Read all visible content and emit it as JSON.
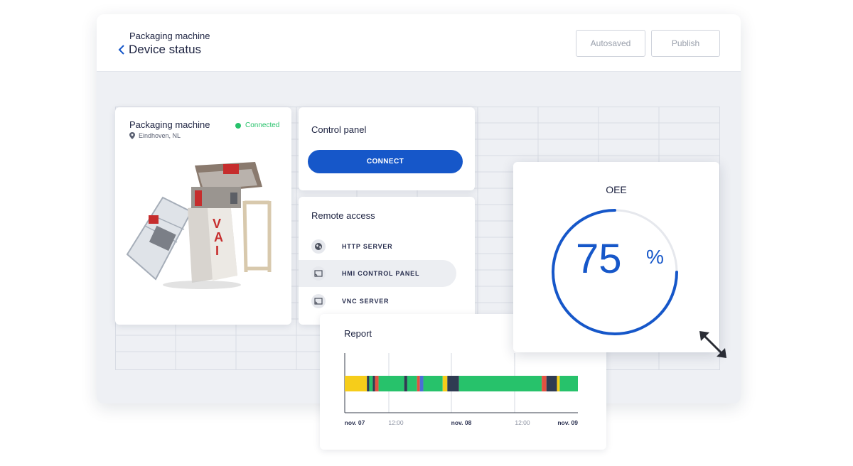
{
  "header": {
    "subtitle": "Packaging machine",
    "title": "Device status",
    "autosaved_label": "Autosaved",
    "publish_label": "Publish"
  },
  "device": {
    "name": "Packaging machine",
    "status": "Connected",
    "location": "Eindhoven, NL",
    "status_color": "#27c26b"
  },
  "control_panel": {
    "title": "Control panel",
    "connect_label": "CONNECT",
    "button_color": "#1657c9"
  },
  "remote_access": {
    "title": "Remote access",
    "items": [
      {
        "label": "HTTP SERVER",
        "icon": "globe-icon",
        "active": false
      },
      {
        "label": "HMI CONTROL PANEL",
        "icon": "cast-icon",
        "active": true
      },
      {
        "label": "VNC SERVER",
        "icon": "cast-icon",
        "active": false
      }
    ]
  },
  "report": {
    "title": "Report",
    "axis_labels": [
      {
        "label": "nov. 07",
        "bold": true
      },
      {
        "label": "12:00",
        "bold": false
      },
      {
        "label": "nov. 08",
        "bold": true
      },
      {
        "label": "12:00",
        "bold": false
      },
      {
        "label": "nov. 09",
        "bold": true
      }
    ],
    "timeline_segments": [
      {
        "start": 0.0,
        "end": 0.095,
        "color": "#f6cd1a"
      },
      {
        "start": 0.095,
        "end": 0.105,
        "color": "#2f3b52"
      },
      {
        "start": 0.105,
        "end": 0.12,
        "color": "#27c26b"
      },
      {
        "start": 0.12,
        "end": 0.13,
        "color": "#2f3b52"
      },
      {
        "start": 0.13,
        "end": 0.145,
        "color": "#e25241"
      },
      {
        "start": 0.145,
        "end": 0.255,
        "color": "#27c26b"
      },
      {
        "start": 0.255,
        "end": 0.268,
        "color": "#2f3b52"
      },
      {
        "start": 0.268,
        "end": 0.31,
        "color": "#27c26b"
      },
      {
        "start": 0.31,
        "end": 0.322,
        "color": "#e25241"
      },
      {
        "start": 0.322,
        "end": 0.337,
        "color": "#4a6fd6"
      },
      {
        "start": 0.337,
        "end": 0.42,
        "color": "#27c26b"
      },
      {
        "start": 0.42,
        "end": 0.44,
        "color": "#f6cd1a"
      },
      {
        "start": 0.44,
        "end": 0.49,
        "color": "#2f3b52"
      },
      {
        "start": 0.49,
        "end": 0.845,
        "color": "#27c26b"
      },
      {
        "start": 0.845,
        "end": 0.865,
        "color": "#e25241"
      },
      {
        "start": 0.865,
        "end": 0.91,
        "color": "#2f3b52"
      },
      {
        "start": 0.91,
        "end": 0.922,
        "color": "#f6cd1a"
      },
      {
        "start": 0.922,
        "end": 1.0,
        "color": "#27c26b"
      }
    ]
  },
  "oee": {
    "title": "OEE",
    "value": "75",
    "unit": "%",
    "fraction": 0.75,
    "arc_color": "#1657c9",
    "track_color": "#e6e8ed"
  }
}
